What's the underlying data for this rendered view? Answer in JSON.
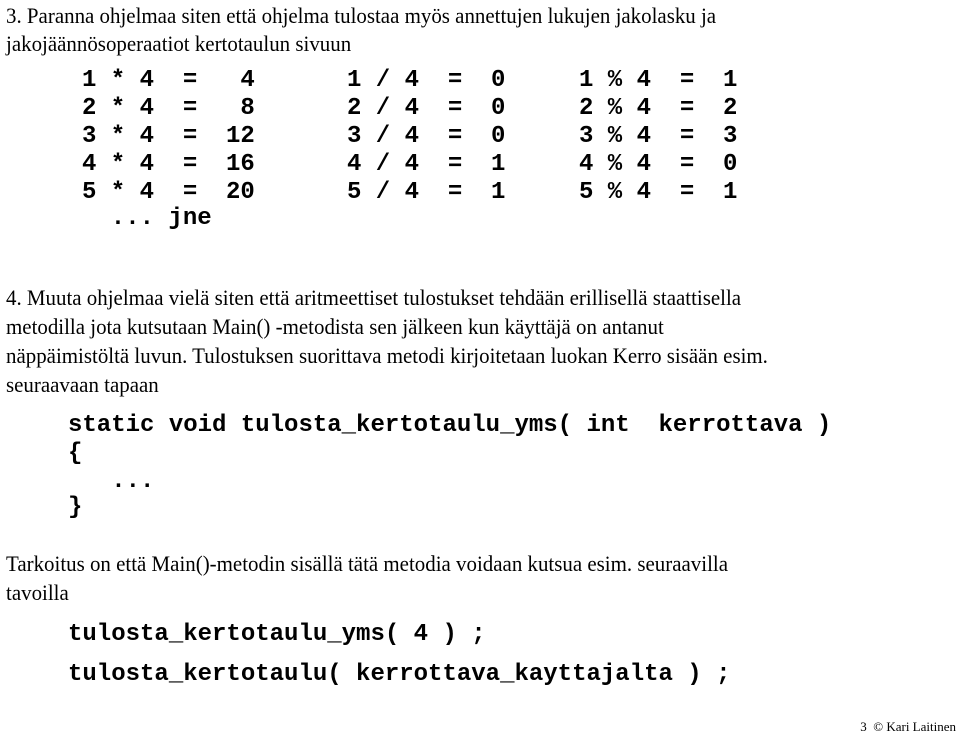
{
  "task3": {
    "heading_line1": "3. Paranna ohjelmaa siten että ohjelma tulostaa myös annettujen lukujen jakolasku ja",
    "heading_line2": "jakojäännösoperaatiot kertotaulun sivuun",
    "rows": [
      {
        "mul": "1 * 4  =   4",
        "div": "1 / 4  =  0",
        "mod": "1 % 4  =  1"
      },
      {
        "mul": "2 * 4  =   8",
        "div": "2 / 4  =  0",
        "mod": "2 % 4  =  2"
      },
      {
        "mul": "3 * 4  =  12",
        "div": "3 / 4  =  0",
        "mod": "3 % 4  =  3"
      },
      {
        "mul": "4 * 4  =  16",
        "div": "4 / 4  =  1",
        "mod": "4 % 4  =  0"
      },
      {
        "mul": "5 * 4  =  20",
        "div": "5 / 4  =  1",
        "mod": "5 % 4  =  1"
      }
    ],
    "etc": "  ... jne"
  },
  "task4": {
    "lines": [
      "4. Muuta ohjelmaa vielä siten että aritmeettiset tulostukset tehdään erillisellä staattisella",
      "metodilla jota kutsutaan Main() -metodista sen jälkeen kun käyttäjä on antanut",
      "näppäimistöltä luvun. Tulostuksen suorittava metodi kirjoitetaan luokan Kerro sisään esim.",
      "seuraavaan tapaan"
    ],
    "code": [
      "static void tulosta_kertotaulu_yms( int  kerrottava )",
      "{",
      "   ...",
      "}"
    ],
    "purpose_lines": [
      "Tarkoitus on että Main()-metodin sisällä tätä metodia voidaan kutsua esim. seuraavilla",
      "tavoilla"
    ],
    "calls": [
      "tulosta_kertotaulu_yms( 4 ) ;",
      "tulosta_kertotaulu( kerrottava_kayttajalta ) ;"
    ]
  },
  "footer": {
    "page_number": "3",
    "copyright": "© Kari Laitinen"
  }
}
